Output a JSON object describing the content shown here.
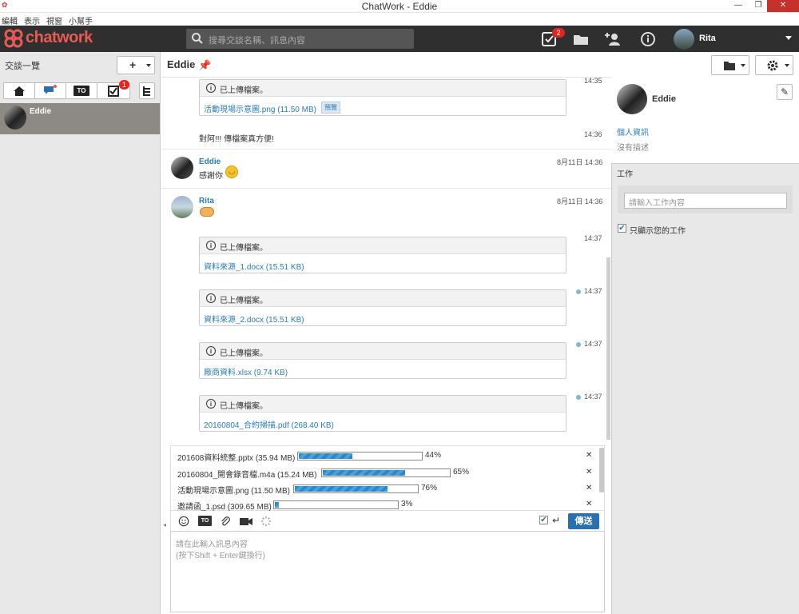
{
  "window": {
    "title": "ChatWork - Eddie"
  },
  "menu": [
    "編輯",
    "表示",
    "視窗",
    "小幫手"
  ],
  "header": {
    "search_placeholder": "搜尋交談名稱、訊息內容",
    "task_badge": "2",
    "user_name": "Rita"
  },
  "sidebar": {
    "title": "交談一覽",
    "add_label": "+",
    "filter_badge": "1",
    "filter_to_label": "TO",
    "rooms": [
      {
        "name": "Eddie"
      }
    ]
  },
  "room": {
    "title": "Eddie"
  },
  "messages": {
    "file_notice": "已上傳檔案。",
    "m1": {
      "file": "活動現場示意圖.png (11.50 MB)",
      "preview": "預覽",
      "time": "14:35"
    },
    "m2": {
      "text": "對阿!!! 傳檔案真方便!",
      "time": "14:36"
    },
    "m3": {
      "sender": "Eddie",
      "text": "感謝你",
      "time": "8月11日 14:36"
    },
    "m4": {
      "sender": "Rita",
      "time": "8月11日 14:36"
    },
    "m5": {
      "file": "資料來源_1.docx (15.51 KB)",
      "time": "14:37"
    },
    "m6": {
      "file": "資料來源_2.docx (15.51 KB)",
      "time": "14:37"
    },
    "m7": {
      "file": "廠商資料.xlsx (9.74 KB)",
      "time": "14:37"
    },
    "m8": {
      "file": "20160804_合約掃描.pdf (268.40 KB)",
      "time": "14:37"
    }
  },
  "uploads": [
    {
      "name": "201608資料統整.pptx (35.94 MB)",
      "percent": 44,
      "label": "44%"
    },
    {
      "name": "20160804_開會錄音檔.m4a (15.24 MB)",
      "percent": 65,
      "label": "65%"
    },
    {
      "name": "活動現場示意圖.png (11.50 MB)",
      "percent": 76,
      "label": "76%"
    },
    {
      "name": "邀請函_1.psd (309.65 MB)",
      "percent": 3,
      "label": "3%"
    }
  ],
  "composer": {
    "to_label": "TO",
    "send_label": "傳送",
    "placeholder_line1": "請在此輸入訊息內容",
    "placeholder_line2": "(按下Shift + Enter鍵換行)"
  },
  "right_panel": {
    "name": "Eddie",
    "profile_link": "個人資訊",
    "description": "沒有描述",
    "task_title": "工作",
    "task_placeholder": "請輸入工作內容",
    "only_mine_label": "只顯示您的工作"
  },
  "colors": {
    "brand": "#e85a56",
    "header_bg": "#2f2f2f",
    "link": "#2a7cb8",
    "send_button": "#2a6fb0",
    "progress": "#2e86c8",
    "badge": "#e2251f"
  }
}
